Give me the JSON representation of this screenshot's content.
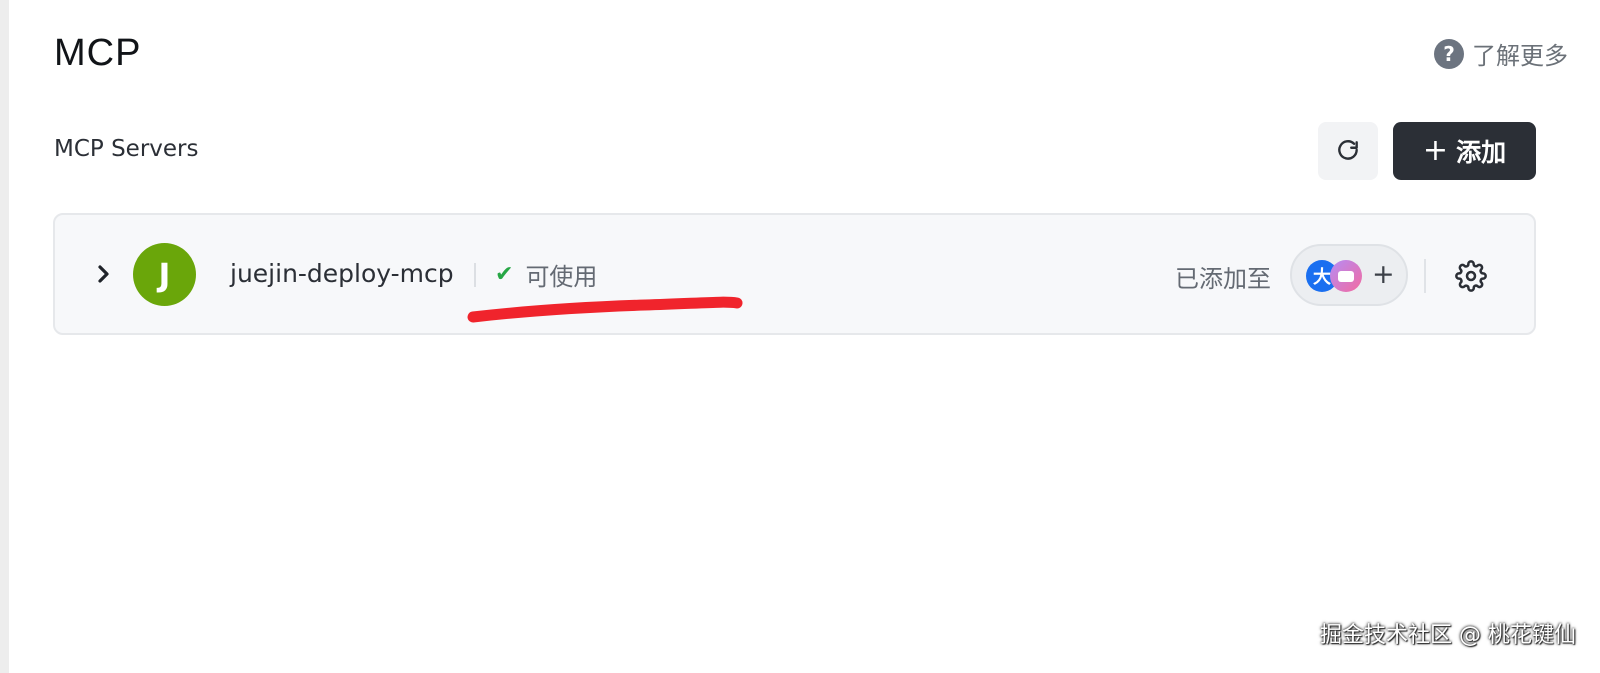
{
  "page": {
    "title": "MCP",
    "learn_more": "了解更多"
  },
  "section": {
    "title": "MCP Servers",
    "add_label": "添加",
    "add_plus": "+"
  },
  "server": {
    "avatar_letter": "J",
    "name": "juejin-deploy-mcp",
    "status_icon": "✔",
    "status": "可使用",
    "added_to_label": "已添加至",
    "client_a_glyph": "大",
    "client_plus": "+"
  },
  "icons": {
    "help": "?"
  },
  "colors": {
    "avatar": "#6aa60a",
    "status_ok": "#27a745",
    "primary_button": "#2b2f36",
    "annotation": "#f0242c"
  },
  "watermark": "掘金技术社区 @ 桃花键仙"
}
